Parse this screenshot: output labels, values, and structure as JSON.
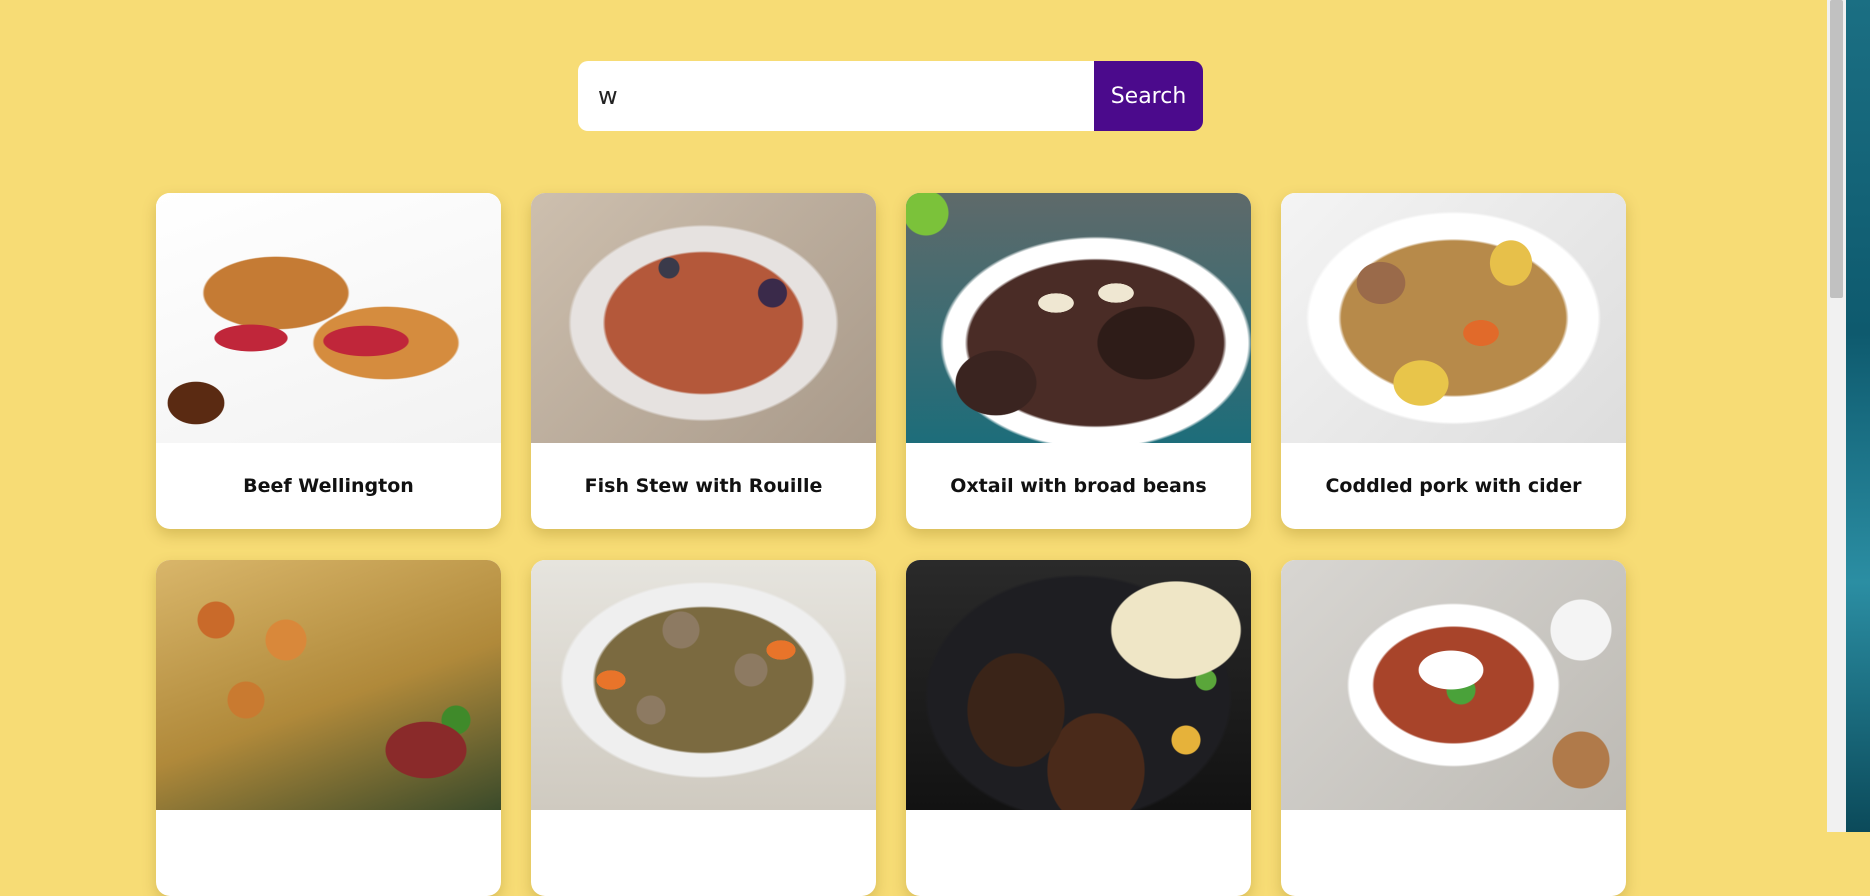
{
  "search": {
    "value": "w",
    "button_label": "Search"
  },
  "recipes": [
    {
      "title": "Beef Wellington",
      "image": "beef-wellington"
    },
    {
      "title": "Fish Stew with Rouille",
      "image": "fish-stew"
    },
    {
      "title": "Oxtail with broad beans",
      "image": "oxtail"
    },
    {
      "title": "Coddled pork with cider",
      "image": "coddled-pork"
    },
    {
      "title": "",
      "image": "potato-gratin-with-chicken"
    },
    {
      "title": "",
      "image": "mushroom-barley-soup"
    },
    {
      "title": "",
      "image": "jerk-chicken"
    },
    {
      "title": "",
      "image": "lentil-curry"
    }
  ],
  "colors": {
    "background": "#f7dc75",
    "button": "#4b0a8c",
    "card": "#ffffff"
  }
}
